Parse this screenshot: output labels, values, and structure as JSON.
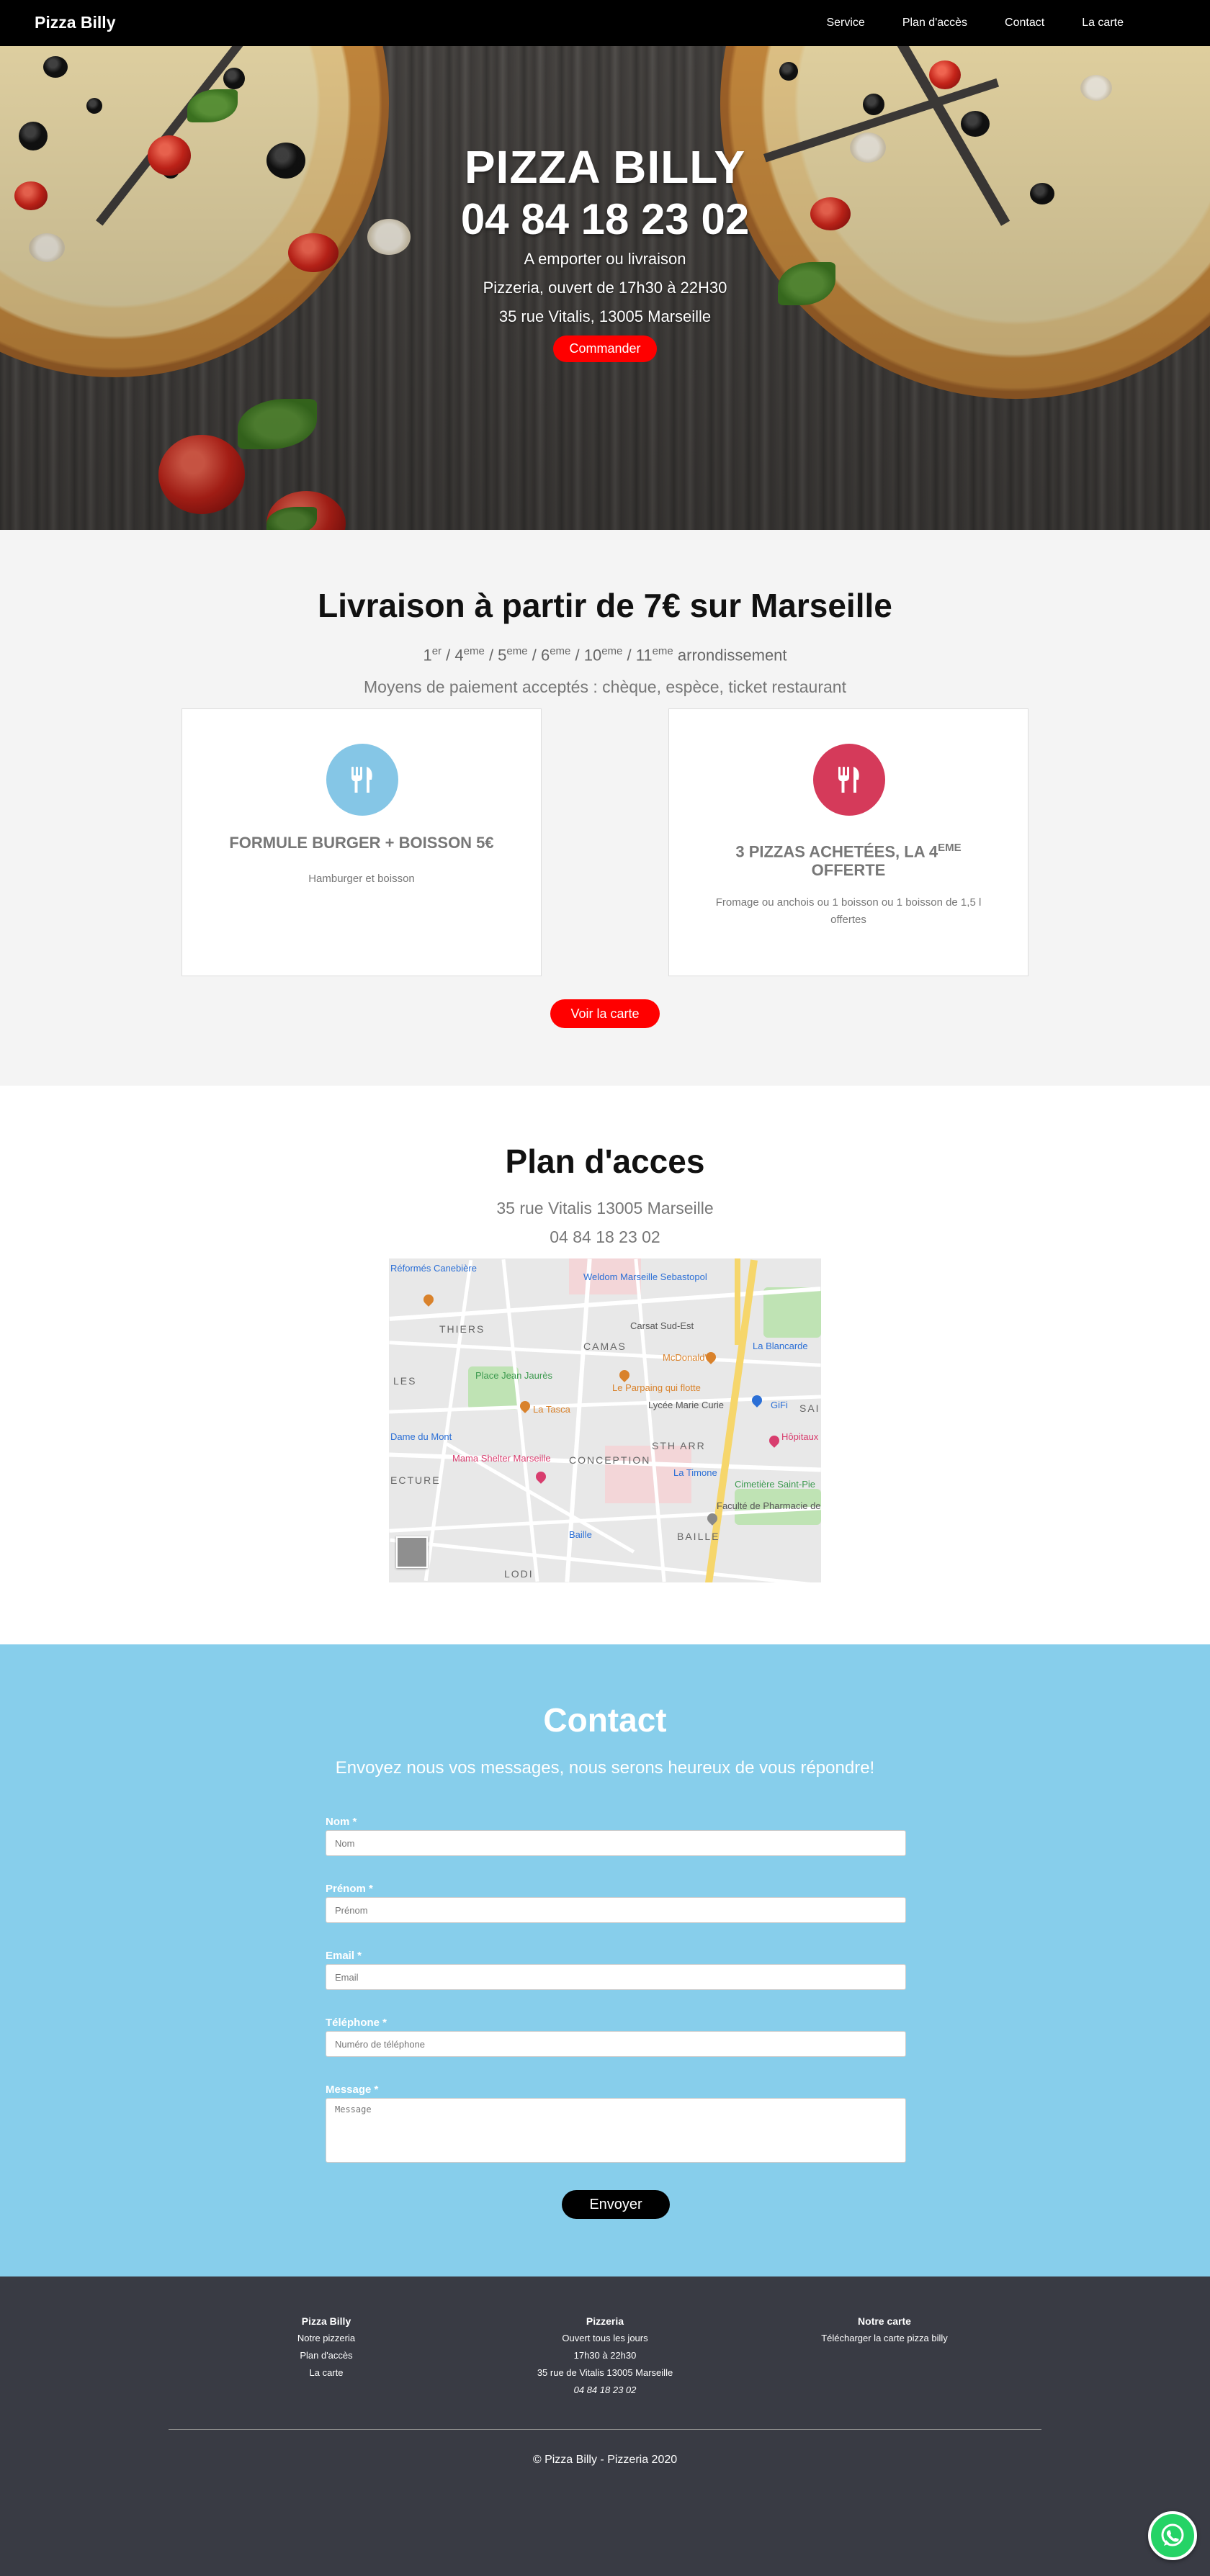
{
  "nav": {
    "brand": "Pizza Billy",
    "links": [
      "Service",
      "Plan d'accès",
      "Contact",
      "La carte"
    ]
  },
  "hero": {
    "title": "PIZZA BILLY",
    "phone": "04 84 18 23 02",
    "line1": "A emporter ou livraison",
    "line2": "Pizzeria, ouvert de 17h30 à 22H30",
    "line3": "35 rue Vitalis, 13005 Marseille",
    "button": "Commander"
  },
  "delivery": {
    "title": "Livraison à partir de 7€ sur Marseille",
    "arrondissements": [
      {
        "n": "1",
        "sup": "er"
      },
      {
        "n": "4",
        "sup": "eme"
      },
      {
        "n": "5",
        "sup": "eme"
      },
      {
        "n": "6",
        "sup": "eme"
      },
      {
        "n": "10",
        "sup": "eme"
      },
      {
        "n": "11",
        "sup": "eme"
      }
    ],
    "arr_suffix": "arrondissement",
    "payment": "Moyens de paiement acceptés : chèque, espèce, ticket restaurant",
    "cards": [
      {
        "title": "FORMULE BURGER + BOISSON 5€",
        "desc": "Hamburger et boisson",
        "icon": "cutlery-icon",
        "color": "#85c6e6"
      },
      {
        "title_main": "3 PIZZAS ACHETÉES, LA 4",
        "title_sup": "EME",
        "title_end": "OFFERTE",
        "desc": "Fromage ou anchois ou 1 boisson ou 1 boisson de 1,5 l offertes",
        "icon": "cutlery-icon",
        "color": "#d53a5a"
      }
    ],
    "button": "Voir la carte"
  },
  "plan": {
    "title": "Plan d'acces",
    "address": "35 rue Vitalis 13005 Marseille",
    "phone": "04 84 18 23 02",
    "map_labels": {
      "reformes": "Réformés Canebière",
      "weldom": "Weldom Marseille Sebastopol",
      "thiers": "THIERS",
      "camas": "CAMAS",
      "carsat": "Carsat Sud-Est",
      "mcdo": "McDonald's",
      "blancarde": "La Blancarde",
      "place_jean": "Place Jean Jaurès",
      "parapluie": "Le Parpaing qui flotte",
      "lycee": "Lycée Marie Curie",
      "gifi": "GiFi",
      "tasca": "La Tasca",
      "les": "LES",
      "notre_dame": "Dame du Mont",
      "mama": "Mama Shelter Marseille",
      "conception": "CONCEPTION",
      "sthar": "STH ARR",
      "hopitaux": "Hôpitaux de Marse",
      "timone": "La Timone",
      "cimetiere": "Cimetière Saint-Pie",
      "pharmacie": "Faculté de Pharmacie de Marseille",
      "baille_m": "Baille",
      "baille": "BAILLE",
      "ecture": "ECTURE",
      "lodi": "LODI",
      "sai": "SAI"
    }
  },
  "contact": {
    "title": "Contact",
    "subtitle": "Envoyez nous vos messages, nous serons heureux de vous répondre!",
    "fields": [
      {
        "label": "Nom *",
        "placeholder": "Nom"
      },
      {
        "label": "Prénom *",
        "placeholder": "Prénom"
      },
      {
        "label": "Email *",
        "placeholder": "Email"
      },
      {
        "label": "Téléphone *",
        "placeholder": "Numéro de téléphone"
      },
      {
        "label": "Message *",
        "placeholder": "Message"
      }
    ],
    "button": "Envoyer"
  },
  "footer": {
    "col1": {
      "title": "Pizza Billy",
      "links": [
        "Notre pizzeria",
        "Plan d'accès",
        "La carte"
      ]
    },
    "col2": {
      "title": "Pizzeria",
      "lines": [
        "Ouvert tous les jours",
        "17h30 à 22h30",
        "35 rue de Vitalis 13005 Marseille",
        "04 84 18 23 02"
      ]
    },
    "col3": {
      "title": "Notre carte",
      "link": "Télécharger la carte pizza billy"
    },
    "copyright": "© Pizza Billy - Pizzeria 2020"
  },
  "colors": {
    "accent_red": "#ff0000",
    "contact_bg": "#87ceeb",
    "footer_bg": "#393b44",
    "card1_icon": "#85c6e6",
    "card2_icon": "#d53a5a",
    "whatsapp": "#25d366"
  }
}
